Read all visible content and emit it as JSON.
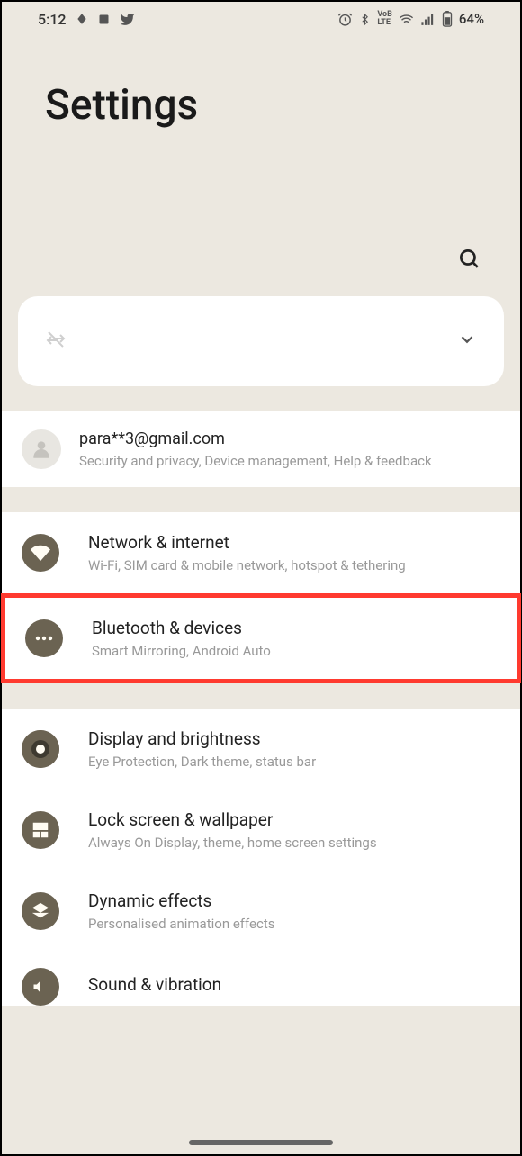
{
  "status": {
    "time": "5:12",
    "battery": "64%"
  },
  "header": {
    "title": "Settings"
  },
  "account": {
    "email": "para**3@gmail.com",
    "sub": "Security and privacy, Device management, Help & feedback"
  },
  "items": [
    {
      "title": "Network & internet",
      "sub": "Wi-Fi, SIM card & mobile network, hotspot & tethering"
    },
    {
      "title": "Bluetooth & devices",
      "sub": "Smart Mirroring, Android Auto"
    },
    {
      "title": "Display and brightness",
      "sub": "Eye Protection, Dark theme, status bar"
    },
    {
      "title": "Lock screen & wallpaper",
      "sub": "Always On Display, theme, home screen settings"
    },
    {
      "title": "Dynamic effects",
      "sub": "Personalised animation effects"
    },
    {
      "title": "Sound & vibration",
      "sub": ""
    }
  ]
}
